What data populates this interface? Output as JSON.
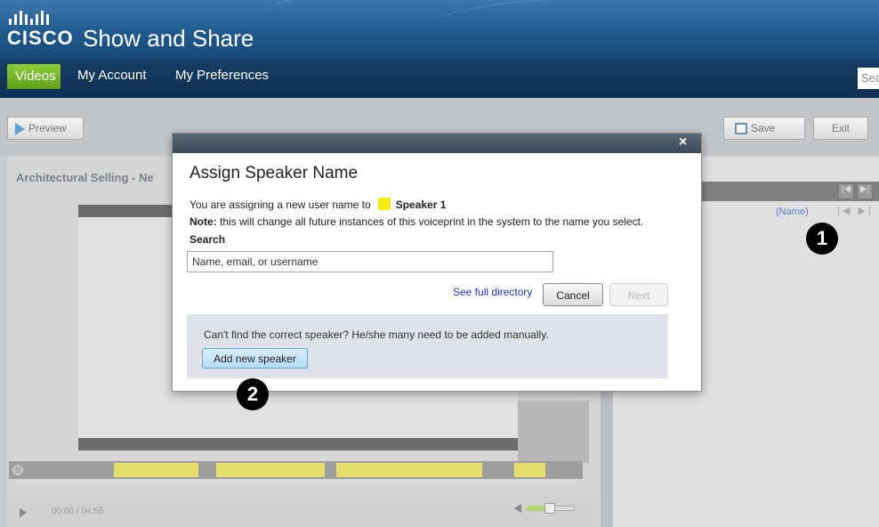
{
  "header": {
    "logo_text": "CISCO",
    "app_title": "Show and Share"
  },
  "nav": {
    "tabs": [
      "Videos",
      "My Account",
      "My Preferences"
    ],
    "active_tab": "Videos",
    "search_partial": "Sea"
  },
  "toolbar": {
    "preview_label": "Preview",
    "save_label": "Save",
    "exit_label": "Exit"
  },
  "video": {
    "title": "Architectural Selling - Ne",
    "time": "00:00 / 04:55"
  },
  "right_panel": {
    "name_link": "(Name)",
    "nav_arrows": "|◀ ▶|"
  },
  "badges": {
    "one": "1",
    "two": "2"
  },
  "dialog": {
    "close": "×",
    "title": "Assign Speaker Name",
    "line1_prefix": "You are assigning a new user name to",
    "speaker": "Speaker 1",
    "note_label": "Note:",
    "note_text": " this will change all future instances of this voiceprint in the system to the name you select.",
    "search_label": "Search",
    "search_placeholder": "Name, email, or username",
    "search_value": "",
    "full_directory": "See full directory",
    "cancel": "Cancel",
    "next": "Next",
    "manual_text": "Can't find the correct speaker? He/she many need to be added manually.",
    "add_button": "Add new speaker"
  },
  "colors": {
    "speaker_swatch": "#f6ed14",
    "active_tab": "#7ab52d",
    "header": "#1f5a8d"
  }
}
